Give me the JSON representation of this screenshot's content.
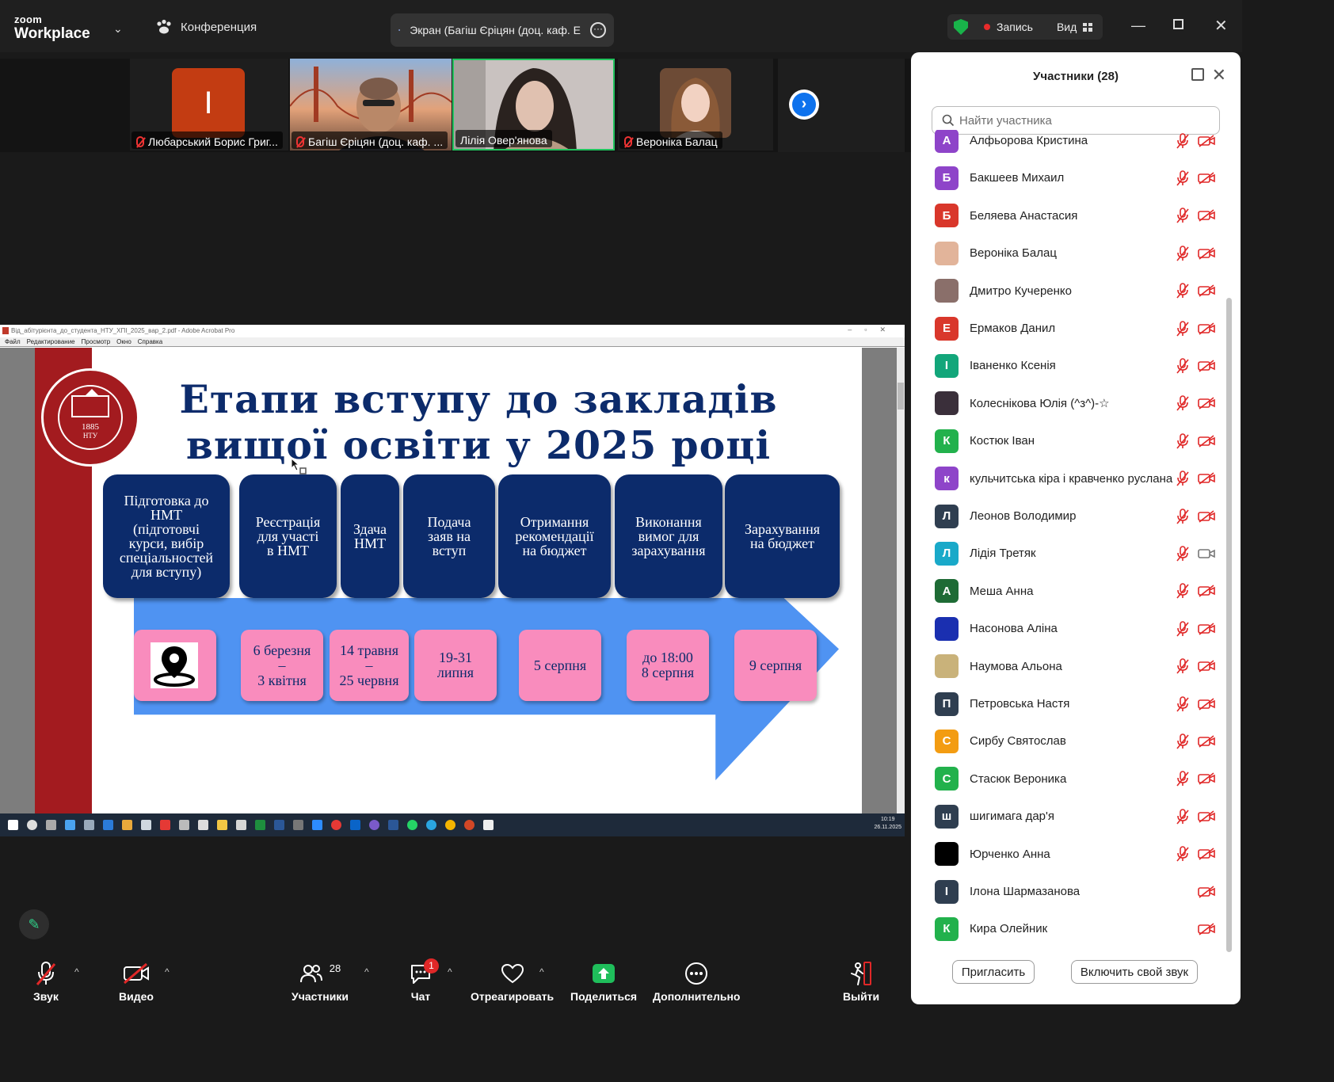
{
  "topbar": {
    "logo_line1": "zoom",
    "logo_line2": "Workplace",
    "conference_label": "Конференция",
    "screen_tab_label": "Экран (Багіш Єріцян (доц. каф. Е",
    "record_label": "Запись",
    "view_label": "Вид",
    "colors": {
      "shield": "#19b34a",
      "record_dot": "#e82b2b"
    }
  },
  "video_strip": {
    "tiles": [
      {
        "name": "Любарський Борис Григ...",
        "avatar_letter": "І",
        "muted": true
      },
      {
        "name": "Багіш Єріцян (доц. каф. ...",
        "muted": true
      },
      {
        "name": "Лілія Овер'янова",
        "muted": false,
        "active_speaker": true
      },
      {
        "name": "Вероніка Балац",
        "muted": true
      }
    ]
  },
  "shared_screen": {
    "window_title": "Від_абітурієнта_до_студента_НТУ_ХПІ_2025_вар_2.pdf - Adobe Acrobat Pro",
    "menu": [
      "Файл",
      "Редактирование",
      "Просмотр",
      "Окно",
      "Справка"
    ],
    "slide": {
      "title_line1": "Етапи вступу до закладів",
      "title_line2": "вищої освіти у 2025 році",
      "seal_year": "1885",
      "seal_abbr": "НТУ",
      "steps": [
        "Підготовка до\nНМТ\n(підготовчі\nкурси, вибір\nспеціальностей\nдля вступу)",
        "Реєстрація\nдля участі\nв НМТ",
        "Здача\nНМТ",
        "Подача\nзаяв на\nвступ",
        "Отримання\nрекомендації\nна бюджет",
        "Виконання\nвимог для\nзарахування",
        "Зарахування\nна бюджет"
      ],
      "dates": [
        "6 березня\n–\n3 квітня",
        "14 травня\n–\n25 червня",
        "19-31\nлипня",
        "5 серпня",
        "до 18:00\n8 серпня",
        "9 серпня"
      ],
      "colors": {
        "dark_blue": "#0c2b6b",
        "red_band": "#a31b1f",
        "arrow": "#4f93f2",
        "pink": "#f98cbd"
      }
    },
    "taskbar_time": "10:19",
    "taskbar_date": "26.11.2025"
  },
  "toolbar": {
    "audio_label": "Звук",
    "video_label": "Видео",
    "participants_label": "Участники",
    "participants_count": "28",
    "chat_label": "Чат",
    "chat_badge": "1",
    "react_label": "Отреагировать",
    "share_label": "Поделиться",
    "more_label": "Дополнительно",
    "leave_label": "Выйти"
  },
  "panel": {
    "title": "Участники (28)",
    "search_placeholder": "Найти участника",
    "invite_label": "Пригласить",
    "unmute_label": "Включить свой звук",
    "participants": [
      {
        "letter": "А",
        "name": "Алфьорова Кристина",
        "color": "#8e44c9",
        "mic_off": true,
        "cam_off": true
      },
      {
        "letter": "Б",
        "name": "Бакшеев Михаил",
        "color": "#8e44c9",
        "mic_off": true,
        "cam_off": true
      },
      {
        "letter": "Б",
        "name": "Беляева Анастасия",
        "color": "#d9372b",
        "mic_off": true,
        "cam_off": true
      },
      {
        "letter": "",
        "name": "Вероніка Балац",
        "color": "#e2b49a",
        "mic_off": true,
        "cam_off": true
      },
      {
        "letter": "",
        "name": "Дмитро Кучеренко",
        "color": "#8a6f6a",
        "mic_off": true,
        "cam_off": true
      },
      {
        "letter": "Е",
        "name": "Ермаков Данил",
        "color": "#d9372b",
        "mic_off": true,
        "cam_off": true
      },
      {
        "letter": "І",
        "name": "Іваненко Ксенія",
        "color": "#12a67a",
        "mic_off": true,
        "cam_off": true
      },
      {
        "letter": "",
        "name": "Колеснікова Юлія (^з^)-☆",
        "color": "#3a2f3a",
        "mic_off": true,
        "cam_off": true
      },
      {
        "letter": "К",
        "name": "Костюк Іван",
        "color": "#22b14c",
        "mic_off": true,
        "cam_off": true
      },
      {
        "letter": "к",
        "name": "кульчитська кіра і кравченко руслана",
        "color": "#8e44c9",
        "mic_off": true,
        "cam_off": true
      },
      {
        "letter": "Л",
        "name": "Леонов Володимир",
        "color": "#2f3e50",
        "mic_off": true,
        "cam_off": true
      },
      {
        "letter": "Л",
        "name": "Лідія Третяк",
        "color": "#19a9c9",
        "mic_off": true,
        "cam_off": false
      },
      {
        "letter": "A",
        "name": "Меша Анна",
        "color": "#1e6b35",
        "mic_off": true,
        "cam_off": true
      },
      {
        "letter": "",
        "name": "Насонова Аліна",
        "color": "#1a2fb0",
        "mic_off": true,
        "cam_off": true
      },
      {
        "letter": "",
        "name": "Наумова Альона",
        "color": "#c9b27a",
        "mic_off": true,
        "cam_off": true
      },
      {
        "letter": "П",
        "name": "Петровська Настя",
        "color": "#2f3e50",
        "mic_off": true,
        "cam_off": true
      },
      {
        "letter": "С",
        "name": "Сирбу Святослав",
        "color": "#f39c12",
        "mic_off": true,
        "cam_off": true
      },
      {
        "letter": "С",
        "name": "Стасюк Вероника",
        "color": "#22b14c",
        "mic_off": true,
        "cam_off": true
      },
      {
        "letter": "ш",
        "name": "шигимага дар'я",
        "color": "#2f3e50",
        "mic_off": true,
        "cam_off": true
      },
      {
        "letter": "",
        "name": "Юрченко Анна",
        "color": "#000000",
        "mic_off": true,
        "cam_off": true
      },
      {
        "letter": "І",
        "name": "Ілона Шармазанова",
        "color": "#2f3e50",
        "mic_off": false,
        "cam_off": true
      },
      {
        "letter": "К",
        "name": "Кира Олейник",
        "color": "#22b14c",
        "mic_off": false,
        "cam_off": true
      }
    ]
  }
}
